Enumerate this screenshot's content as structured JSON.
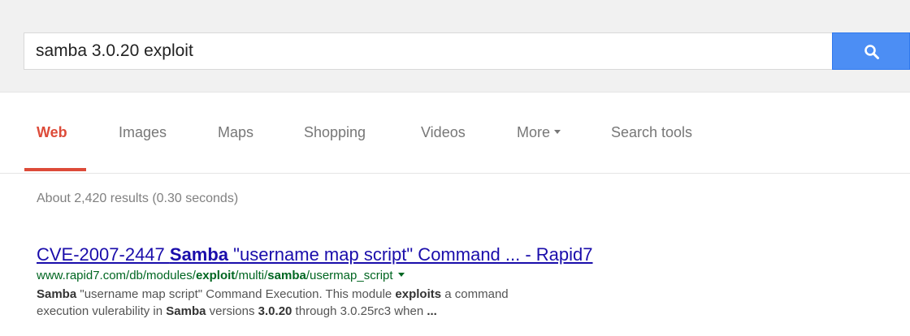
{
  "search": {
    "query": "samba 3.0.20 exploit",
    "button_icon": "search-icon",
    "accent": "#4c8ef4"
  },
  "tabs": [
    {
      "label": "Web",
      "active": true
    },
    {
      "label": "Images"
    },
    {
      "label": "Maps"
    },
    {
      "label": "Shopping"
    },
    {
      "label": "Videos"
    },
    {
      "label": "More"
    },
    {
      "label": "Search tools"
    }
  ],
  "results_stats": "About 2,420 results (0.30 seconds)",
  "result": {
    "title": {
      "part1": "CVE-2007-2447 ",
      "bold1": "Samba",
      "part2": " \"username map script\" Command ... - Rapid7"
    },
    "url": {
      "part1": "www.rapid7.com/db/modules/",
      "bold1": "exploit",
      "part2": "/multi/",
      "bold2": "samba",
      "part3": "/usermap_script"
    },
    "snippet": {
      "line1": {
        "bold1": "Samba",
        "part1": " \"username map script\" Command Execution. This module ",
        "bold2": "exploits",
        "part2": " a command"
      },
      "line2": {
        "part1": "execution vulerability in ",
        "bold1": "Samba",
        "part2": " versions ",
        "bold2": "3.0.20",
        "part3": " through 3.0.25rc3 when ",
        "bold3": "..."
      }
    }
  },
  "colors": {
    "active_tab": "#dd4b39",
    "link": "#1a0dab",
    "url": "#006621"
  }
}
